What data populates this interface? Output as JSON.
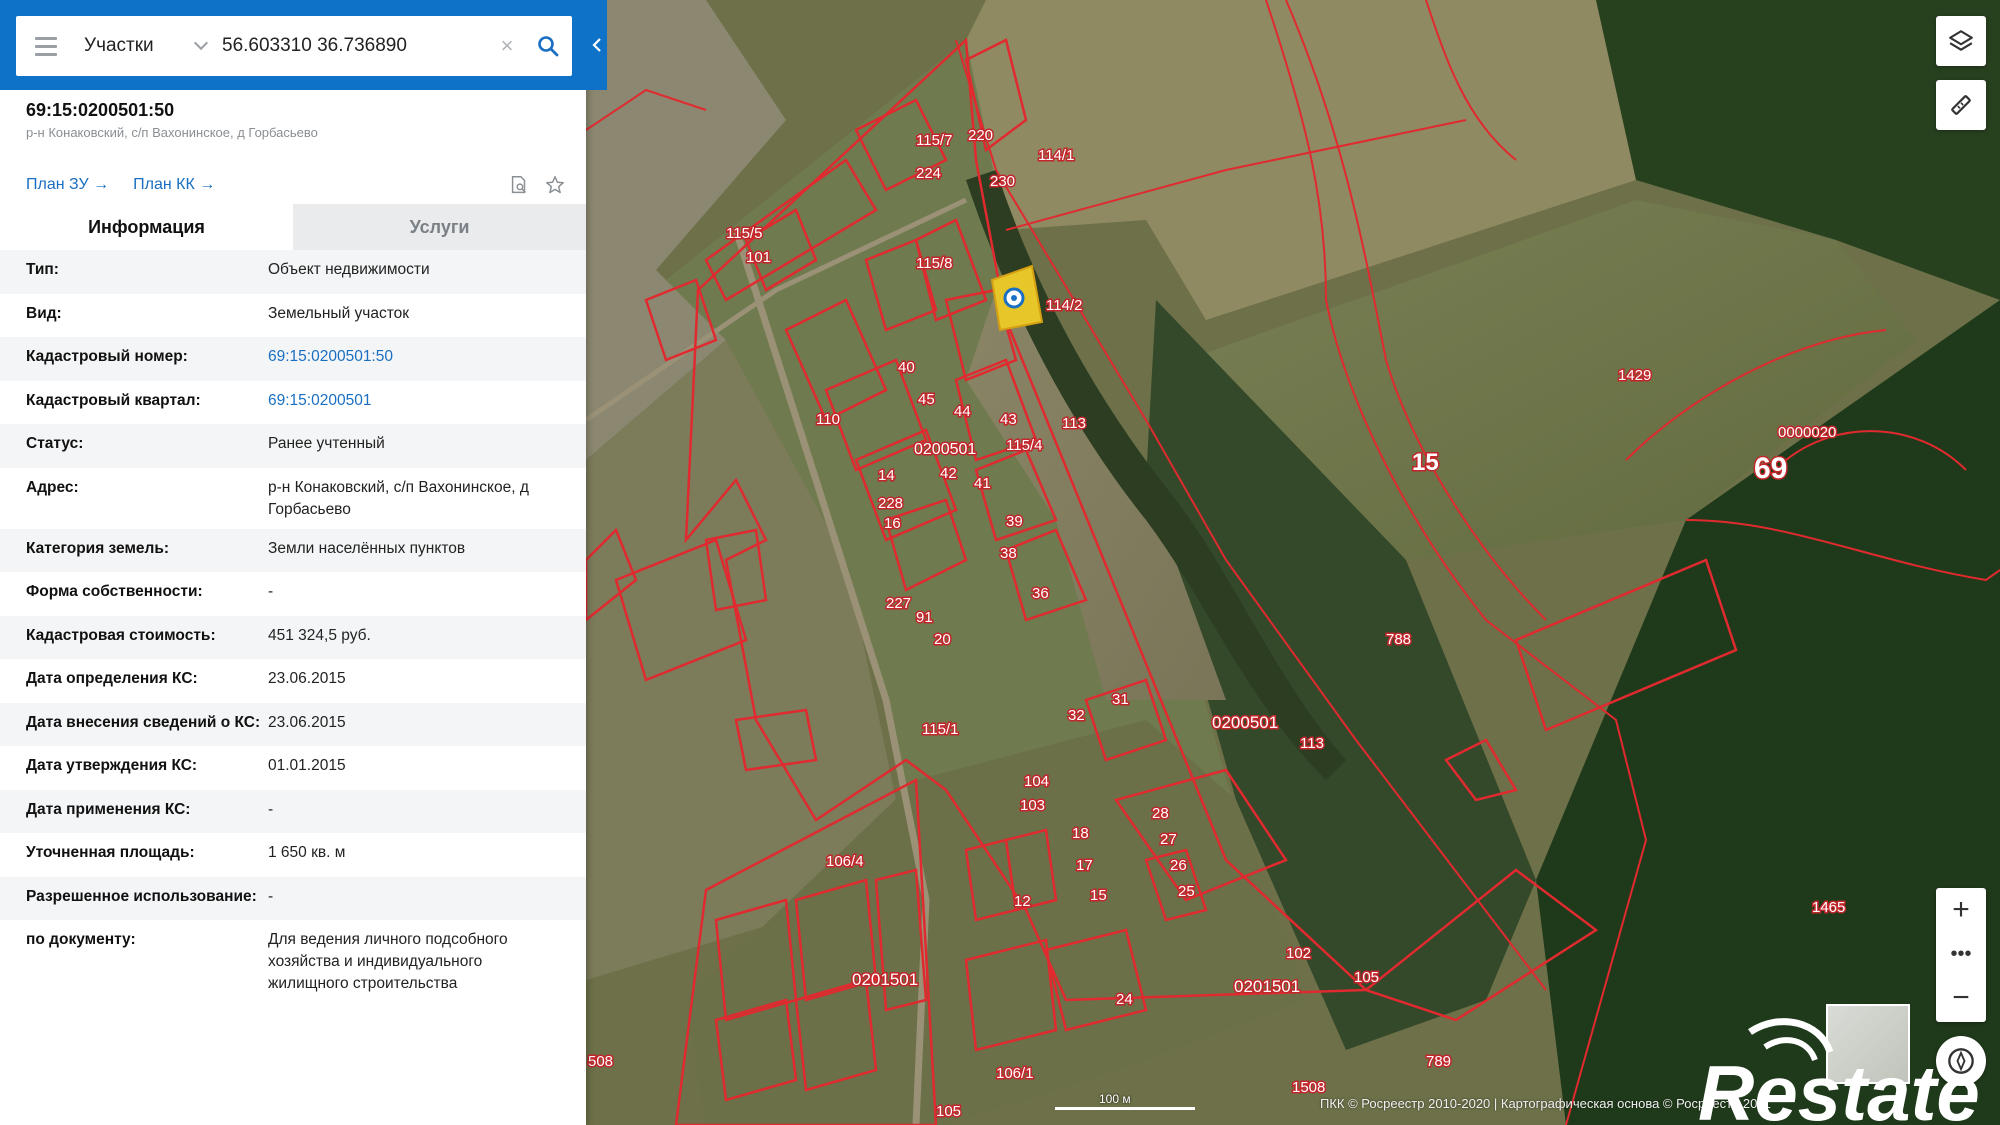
{
  "search": {
    "layer": "Участки",
    "query": "56.603310 36.736890",
    "clear_icon": "×"
  },
  "object": {
    "title": "69:15:0200501:50",
    "subtitle": "р-н Конаковский, с/п Вахонинское, д Горбасьево"
  },
  "links": {
    "plan_zu": "План ЗУ →",
    "plan_kk": "План КК →"
  },
  "tabs": [
    {
      "label": "Информация"
    },
    {
      "label": "Услуги"
    }
  ],
  "info": [
    {
      "key": "Тип:",
      "value": "Объект недвижимости"
    },
    {
      "key": "Вид:",
      "value": "Земельный участок"
    },
    {
      "key": "Кадастровый номер:",
      "value": "69:15:0200501:50"
    },
    {
      "key": "Кадастровый квартал:",
      "value": "69:15:0200501"
    },
    {
      "key": "Статус:",
      "value": "Ранее учтенный"
    },
    {
      "key": "Адрес:",
      "value": "р-н Конаковский, с/п Вахонинское, д Горбасьево"
    },
    {
      "key": "Категория земель:",
      "value": "Земли населённых пунктов"
    },
    {
      "key": "Форма собственности:",
      "value": "-"
    },
    {
      "key": "Кадастровая стоимость:",
      "value": "451 324,5 руб."
    },
    {
      "key": "Дата определения КС:",
      "value": "23.06.2015"
    },
    {
      "key": "Дата внесения сведений о КС:",
      "value": "23.06.2015"
    },
    {
      "key": "Дата утверждения КС:",
      "value": "01.01.2015"
    },
    {
      "key": "Дата применения КС:",
      "value": "-"
    },
    {
      "key": "Уточненная площадь:",
      "value": "1 650 кв. м"
    },
    {
      "key": "Разрешенное использование:",
      "value": "-"
    },
    {
      "key": "по документу:",
      "value": "Для ведения личного подсобного хозяйства и индивидуального жилищного строительства"
    }
  ],
  "map": {
    "labels": [
      "1429",
      "0000020",
      "15",
      "69",
      "788",
      "0200501",
      "0200501",
      "113",
      "113",
      "1465",
      "0201501",
      "0201501",
      "105",
      "105",
      "1508",
      "789",
      "110",
      "115/7",
      "115/8",
      "115/5",
      "115/4",
      "115/1",
      "114/2",
      "114/1",
      "106/4",
      "106/1",
      "101",
      "103",
      "104",
      "102",
      "45",
      "44",
      "43",
      "42",
      "41",
      "40",
      "39",
      "38",
      "36",
      "32",
      "31",
      "28",
      "27",
      "26",
      "25",
      "24",
      "18",
      "17",
      "16",
      "15",
      "14",
      "12",
      "91",
      "20",
      "227",
      "228",
      "508",
      "220",
      "224",
      "230"
    ],
    "scale_label": "100 м",
    "copyright": "ПКК © Росреестр 2010-2020 | Картографическая основа © Росреестр 2011"
  },
  "watermark": "Restate",
  "colors": {
    "header_blue": "#0e72c9",
    "link_blue": "#1a6fc2",
    "boundary_red": "#d7262b",
    "selected_parcel": "#e6c629"
  },
  "icons": [
    "menu-icon",
    "chevron-down-icon",
    "close-icon",
    "search-icon",
    "chevron-left-icon",
    "document-search-icon",
    "star-icon",
    "layers-icon",
    "ruler-icon",
    "plus-icon",
    "more-icon",
    "minus-icon",
    "compass-icon"
  ]
}
